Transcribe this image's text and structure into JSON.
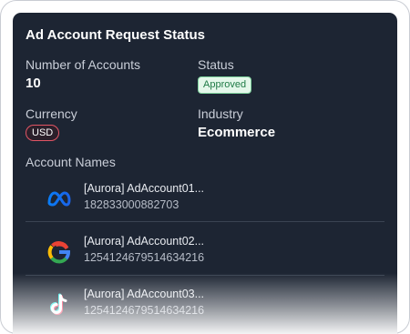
{
  "card": {
    "title": "Ad Account Request Status",
    "number_of_accounts_label": "Number of Accounts",
    "number_of_accounts_value": "10",
    "status_label": "Status",
    "status_value": "Approved",
    "currency_label": "Currency",
    "currency_value": "USD",
    "industry_label": "Industry",
    "industry_value": "Ecommerce",
    "account_names_label": "Account Names",
    "accounts": [
      {
        "platform_icon": "meta-icon",
        "name": "[Aurora] AdAccount01...",
        "id": "182833000882703"
      },
      {
        "platform_icon": "google-icon",
        "name": "[Aurora] AdAccount02...",
        "id": "1254124679514634216"
      },
      {
        "platform_icon": "tiktok-icon",
        "name": "[Aurora] AdAccount03...",
        "id": "1254124679514634216"
      }
    ]
  },
  "colors": {
    "card_background": "#1d2533",
    "approved_badge": "#e4f7ea",
    "usd_badge_border": "#e25565"
  }
}
